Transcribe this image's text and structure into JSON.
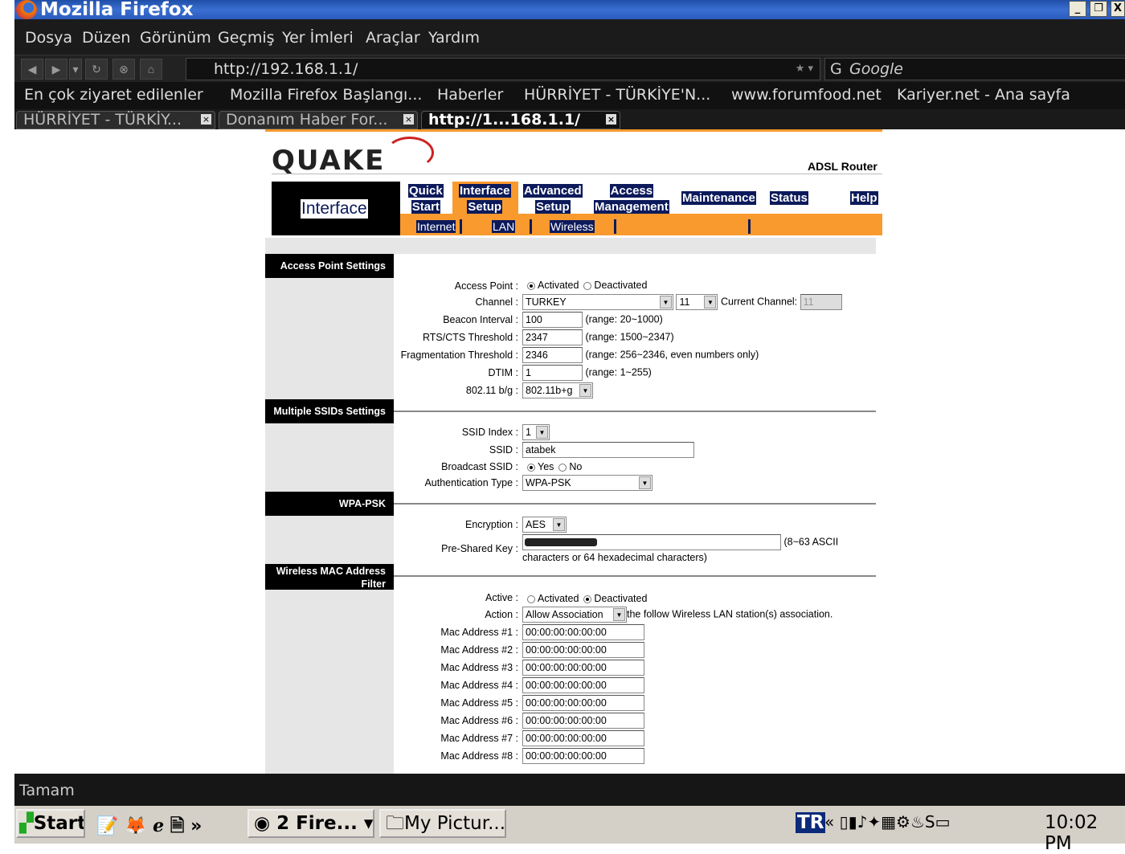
{
  "browser": {
    "title": "Mozilla Firefox",
    "menu": [
      "Dosya",
      "Düzen",
      "Görünüm",
      "Geçmiş",
      "Yer İmleri",
      "Araçlar",
      "Yardım"
    ],
    "url": "http://192.168.1.1/",
    "search_placeholder": "Google",
    "bookmarks": [
      "En çok ziyaret edilenler",
      "Mozilla Firefox Başlangı...",
      "Haberler",
      "HÜRRİYET - TÜRKİYE'N...",
      "www.forumfood.net",
      "Kariyer.net - Ana sayfa"
    ],
    "tabs": [
      "HÜRRİYET - TÜRKİY...",
      "Donanım Haber For...",
      "http://1...168.1.1/"
    ],
    "status": "Tamam"
  },
  "router": {
    "logo": "QUAKE",
    "product": "ADSL Router",
    "current_section": "Interface",
    "nav": [
      {
        "l1": "Quick",
        "l2": "Start"
      },
      {
        "l1": "Interface",
        "l2": "Setup"
      },
      {
        "l1": "Advanced",
        "l2": "Setup"
      },
      {
        "l1": "Access",
        "l2": "Management"
      },
      {
        "l1": "Maintenance"
      },
      {
        "l1": "Status"
      },
      {
        "l1": "Help"
      }
    ],
    "subnav": [
      "Internet",
      "LAN",
      "Wireless"
    ],
    "sections": {
      "ap": "Access Point Settings",
      "ssid": "Multiple SSIDs Settings",
      "wpa": "WPA-PSK",
      "mac": "Wireless MAC Address Filter"
    },
    "ap": {
      "access_point_label": "Access Point :",
      "activated": "Activated",
      "deactivated": "Deactivated",
      "channel_label": "Channel :",
      "country": "TURKEY",
      "channel": "11",
      "current_channel_label": "Current Channel:",
      "current_channel": "11",
      "beacon_label": "Beacon Interval :",
      "beacon": "100",
      "beacon_range": "(range: 20~1000)",
      "rts_label": "RTS/CTS Threshold :",
      "rts": "2347",
      "rts_range": "(range: 1500~2347)",
      "frag_label": "Fragmentation Threshold :",
      "frag": "2346",
      "frag_range": "(range: 256~2346, even numbers only)",
      "dtim_label": "DTIM :",
      "dtim": "1",
      "dtim_range": "(range: 1~255)",
      "mode_label": "802.11 b/g :",
      "mode": "802.11b+g"
    },
    "ssid": {
      "index_label": "SSID Index :",
      "index": "1",
      "ssid_label": "SSID :",
      "ssid": "atabek",
      "broadcast_label": "Broadcast SSID :",
      "yes": "Yes",
      "no": "No",
      "auth_label": "Authentication Type :",
      "auth": "WPA-PSK"
    },
    "wpa": {
      "enc_label": "Encryption :",
      "enc": "AES",
      "psk_label": "Pre-Shared Key :",
      "psk_hint1": "(8~63 ASCII",
      "psk_hint2": "characters or 64 hexadecimal characters)"
    },
    "mac": {
      "active_label": "Active :",
      "activated": "Activated",
      "deactivated": "Deactivated",
      "action_label": "Action :",
      "action": "Allow Association",
      "action_hint": "the follow Wireless LAN station(s) association.",
      "addresses": [
        {
          "label": "Mac Address #1 :",
          "value": "00:00:00:00:00:00"
        },
        {
          "label": "Mac Address #2 :",
          "value": "00:00:00:00:00:00"
        },
        {
          "label": "Mac Address #3 :",
          "value": "00:00:00:00:00:00"
        },
        {
          "label": "Mac Address #4 :",
          "value": "00:00:00:00:00:00"
        },
        {
          "label": "Mac Address #5 :",
          "value": "00:00:00:00:00:00"
        },
        {
          "label": "Mac Address #6 :",
          "value": "00:00:00:00:00:00"
        },
        {
          "label": "Mac Address #7 :",
          "value": "00:00:00:00:00:00"
        },
        {
          "label": "Mac Address #8 :",
          "value": "00:00:00:00:00:00"
        }
      ]
    }
  },
  "taskbar": {
    "start": "Start",
    "items": [
      "2 Fire...",
      "My Pictur..."
    ],
    "lang": "TR",
    "clock": "10:02 PM"
  }
}
